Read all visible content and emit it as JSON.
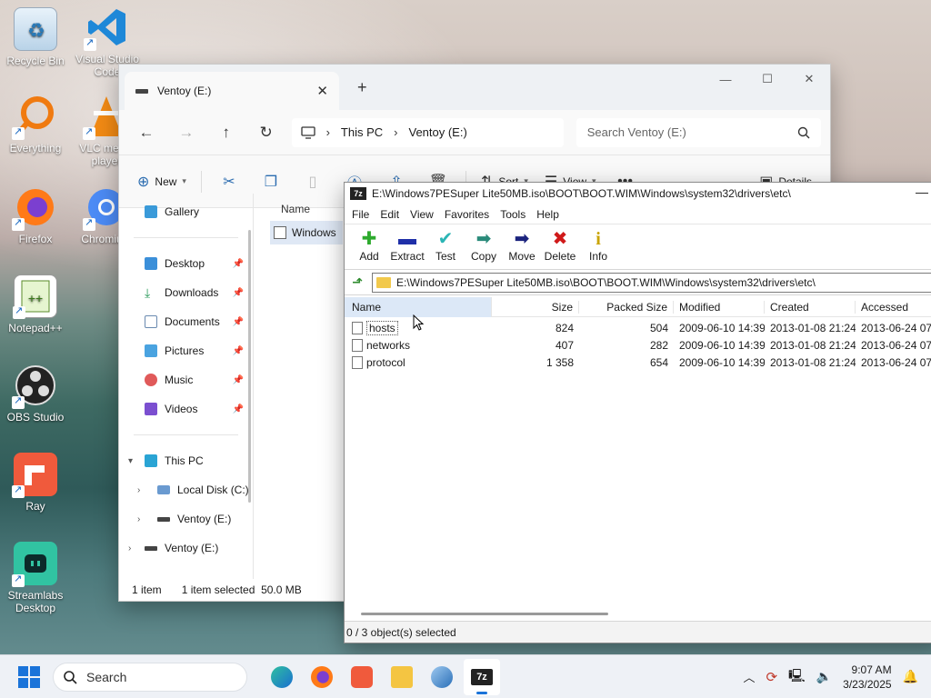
{
  "desktop": {
    "icons": [
      {
        "label": "Recycle Bin"
      },
      {
        "label": "Visual Studio Code"
      },
      {
        "label": "Everything"
      },
      {
        "label": "VLC media player"
      },
      {
        "label": "Firefox"
      },
      {
        "label": "Chromium"
      },
      {
        "label": "Notepad++"
      },
      {
        "label": "OBS Studio"
      },
      {
        "label": "Ray"
      },
      {
        "label": "Streamlabs Desktop"
      }
    ]
  },
  "explorer": {
    "tab_title": "Ventoy (E:)",
    "breadcrumb": [
      "This PC",
      "Ventoy (E:)"
    ],
    "search_placeholder": "Search Ventoy (E:)",
    "commands": {
      "new": "New",
      "sort": "Sort",
      "view": "View",
      "details": "Details"
    },
    "sidebar": {
      "top": [
        {
          "label": "Gallery"
        }
      ],
      "quick": [
        {
          "label": "Desktop"
        },
        {
          "label": "Downloads"
        },
        {
          "label": "Documents"
        },
        {
          "label": "Pictures"
        },
        {
          "label": "Music"
        },
        {
          "label": "Videos"
        }
      ],
      "tree": [
        {
          "label": "This PC"
        },
        {
          "label": "Local Disk (C:)"
        },
        {
          "label": "Ventoy (E:)"
        },
        {
          "label": "Ventoy (E:)"
        }
      ]
    },
    "content": {
      "column_name": "Name",
      "file_label": "Windows"
    },
    "status": {
      "count": "1 item",
      "selected": "1 item selected",
      "size": "50.0 MB"
    }
  },
  "sevenzip": {
    "title": "E:\\Windows7PESuper Lite50MB.iso\\BOOT\\BOOT.WIM\\Windows\\system32\\drivers\\etc\\",
    "logo": "7z",
    "menu": [
      "File",
      "Edit",
      "View",
      "Favorites",
      "Tools",
      "Help"
    ],
    "toolbar": [
      {
        "label": "Add",
        "glyph": "✚",
        "color": "#2eaa2e"
      },
      {
        "label": "Extract",
        "glyph": "▬",
        "color": "#1f2fa8"
      },
      {
        "label": "Test",
        "glyph": "✔",
        "color": "#2bb5b5"
      },
      {
        "label": "Copy",
        "glyph": "➡",
        "color": "#2a8a7a"
      },
      {
        "label": "Move",
        "glyph": "➡",
        "color": "#1b237d"
      },
      {
        "label": "Delete",
        "glyph": "✖",
        "color": "#d01a1a"
      },
      {
        "label": "Info",
        "glyph": "i",
        "color": "#c9a400"
      }
    ],
    "path": "E:\\Windows7PESuper Lite50MB.iso\\BOOT\\BOOT.WIM\\Windows\\system32\\drivers\\etc\\",
    "columns": {
      "name": "Name",
      "size": "Size",
      "packed": "Packed Size",
      "modified": "Modified",
      "created": "Created",
      "accessed": "Accessed"
    },
    "files": [
      {
        "name": "hosts",
        "size": "824",
        "packed": "504",
        "modified": "2009-06-10 14:39",
        "created": "2013-01-08 21:24",
        "accessed": "2013-06-24 07:0"
      },
      {
        "name": "networks",
        "size": "407",
        "packed": "282",
        "modified": "2009-06-10 14:39",
        "created": "2013-01-08 21:24",
        "accessed": "2013-06-24 07:0"
      },
      {
        "name": "protocol",
        "size": "1 358",
        "packed": "654",
        "modified": "2009-06-10 14:39",
        "created": "2013-01-08 21:24",
        "accessed": "2013-06-24 07:0"
      }
    ],
    "status": "0 / 3 object(s) selected"
  },
  "taskbar": {
    "search_label": "Search",
    "time": "9:07 AM",
    "date": "3/23/2025",
    "active_app": "7z"
  },
  "colors": {
    "accent": "#1a73d9",
    "selection": "#dce8f7"
  }
}
